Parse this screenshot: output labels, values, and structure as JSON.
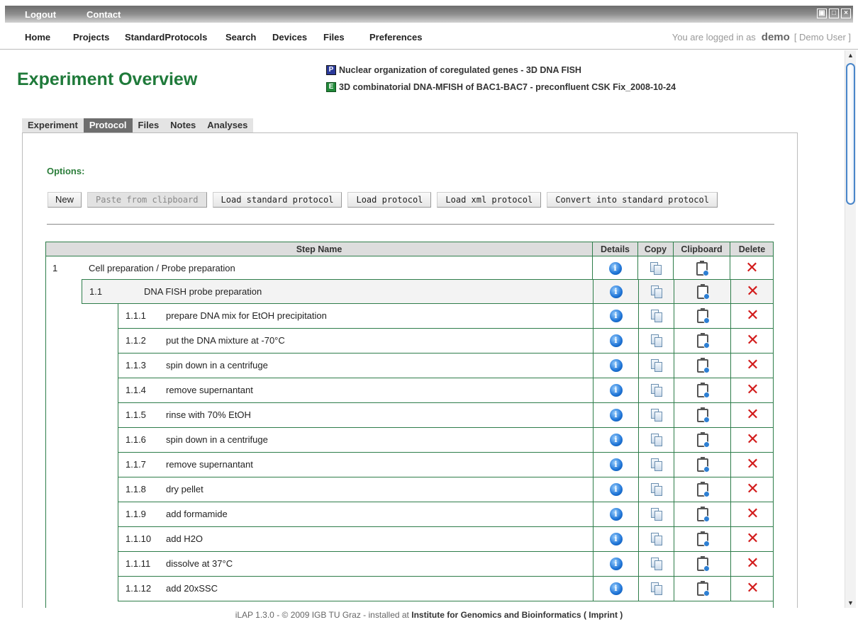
{
  "topbar": {
    "logout": "Logout",
    "contact": "Contact"
  },
  "nav": {
    "items": [
      "Home",
      "Projects",
      "StandardProtocols",
      "Search",
      "Devices",
      "Files",
      "Preferences"
    ],
    "login_prefix": "You are logged in as",
    "user": "demo",
    "user_role": "[ Demo User ]"
  },
  "page": {
    "title": "Experiment Overview",
    "project_badge": "P",
    "project": "Nuclear organization of coregulated genes - 3D DNA FISH",
    "experiment_badge": "E",
    "experiment": "3D combinatorial DNA-MFISH of BAC1-BAC7 - preconfluent CSK Fix_2008-10-24"
  },
  "tabs": [
    "Experiment",
    "Protocol",
    "Files",
    "Notes",
    "Analyses"
  ],
  "active_tab": "Protocol",
  "options": {
    "label": "Options:",
    "buttons": [
      "New",
      "Paste from clipboard",
      "Load standard protocol",
      "Load protocol",
      "Load xml protocol",
      "Convert into standard protocol"
    ]
  },
  "table": {
    "headers": {
      "step": "Step Name",
      "details": "Details",
      "copy": "Copy",
      "clipboard": "Clipboard",
      "delete": "Delete"
    },
    "level1": {
      "num": "1",
      "name": "Cell preparation / Probe preparation"
    },
    "level2": {
      "num": "1.1",
      "name": "DNA FISH probe preparation"
    },
    "steps": [
      {
        "num": "1.1.1",
        "name": "prepare DNA mix for EtOH precipitation"
      },
      {
        "num": "1.1.2",
        "name": "put the DNA mixture at -70°C"
      },
      {
        "num": "1.1.3",
        "name": "spin down in a centrifuge"
      },
      {
        "num": "1.1.4",
        "name": "remove supernantant"
      },
      {
        "num": "1.1.5",
        "name": "rinse with 70% EtOH"
      },
      {
        "num": "1.1.6",
        "name": "spin down in a centrifuge"
      },
      {
        "num": "1.1.7",
        "name": "remove supernantant"
      },
      {
        "num": "1.1.8",
        "name": "dry pellet"
      },
      {
        "num": "1.1.9",
        "name": "add formamide"
      },
      {
        "num": "1.1.10",
        "name": "add H2O"
      },
      {
        "num": "1.1.11",
        "name": "dissolve at 37°C"
      },
      {
        "num": "1.1.12",
        "name": "add 20xSSC"
      }
    ]
  },
  "footer": {
    "version": "iLAP 1.3.0 - © 2009 IGB TU Graz - installed at",
    "institute": "Institute for Genomics and Bioinformatics",
    "imprint": "( Imprint )"
  },
  "colors": {
    "accent": "#1f7a3a",
    "border": "#2e7d4a",
    "delete": "#d21b1b",
    "info": "#1d73d6"
  },
  "icons": {
    "details": "info-icon",
    "copy": "copy-icon",
    "clipboard": "clipboard-icon",
    "delete": "delete-icon"
  }
}
